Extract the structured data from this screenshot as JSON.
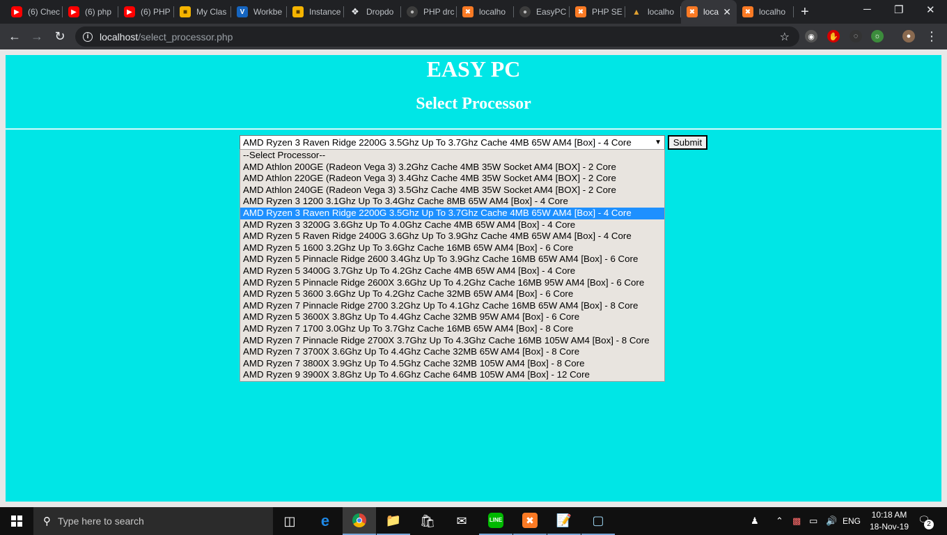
{
  "browser": {
    "tabs": [
      {
        "title": "(6) Chec",
        "icon": "youtube-icon"
      },
      {
        "title": "(6) php",
        "icon": "youtube-icon"
      },
      {
        "title": "(6) PHP",
        "icon": "youtube-icon"
      },
      {
        "title": "My Clas",
        "icon": "box-icon"
      },
      {
        "title": "Workbe",
        "icon": "v-icon"
      },
      {
        "title": "Instance",
        "icon": "box-icon"
      },
      {
        "title": "Dropdo",
        "icon": "dropbox-icon"
      },
      {
        "title": "PHP drc",
        "icon": "github-icon"
      },
      {
        "title": "localho",
        "icon": "xampp-icon"
      },
      {
        "title": "EasyPC",
        "icon": "github-icon"
      },
      {
        "title": "PHP SE",
        "icon": "xampp-icon"
      },
      {
        "title": "localho",
        "icon": "cake-icon"
      },
      {
        "title": "loca",
        "icon": "xampp-icon",
        "active": true
      },
      {
        "title": "localho",
        "icon": "xampp-icon"
      }
    ],
    "new_tab": "+",
    "window_controls": {
      "minimize": "─",
      "restore": "❐",
      "close": "✕"
    },
    "url_host": "localhost",
    "url_path": "/select_processor.php"
  },
  "page": {
    "title": "EASY PC",
    "subtitle": "Select Processor",
    "selected_value": "AMD Ryzen 3 Raven Ridge 2200G 3.5Ghz Up To 3.7Ghz Cache 4MB 65W AM4 [Box] - 4 Core",
    "submit_label": "Submit",
    "options": [
      "--Select Processor--",
      "AMD Athlon 200GE (Radeon Vega 3) 3.2Ghz Cache 4MB 35W Socket AM4 [BOX] - 2 Core",
      "AMD Athlon 220GE (Radeon Vega 3) 3.4Ghz Cache 4MB 35W Socket AM4 [BOX] - 2 Core",
      "AMD Athlon 240GE (Radeon Vega 3) 3.5Ghz Cache 4MB 35W Socket AM4 [BOX] - 2 Core",
      "AMD Ryzen 3 1200 3.1Ghz Up To 3.4Ghz Cache 8MB 65W AM4 [Box] - 4 Core",
      "AMD Ryzen 3 Raven Ridge 2200G 3.5Ghz Up To 3.7Ghz Cache 4MB 65W AM4 [Box] - 4 Core",
      "AMD Ryzen 3 3200G 3.6Ghz Up To 4.0Ghz Cache 4MB 65W AM4 [Box] - 4 Core",
      "AMD Ryzen 5 Raven Ridge 2400G 3.6Ghz Up To 3.9Ghz Cache 4MB 65W AM4 [Box] - 4 Core",
      "AMD Ryzen 5 1600 3.2Ghz Up To 3.6Ghz Cache 16MB 65W AM4 [Box] - 6 Core",
      "AMD Ryzen 5 Pinnacle Ridge 2600 3.4Ghz Up To 3.9Ghz Cache 16MB 65W AM4 [Box] - 6 Core",
      "AMD Ryzen 5 3400G 3.7Ghz Up To 4.2Ghz Cache 4MB 65W AM4 [Box] - 4 Core",
      "AMD Ryzen 5 Pinnacle Ridge 2600X 3.6Ghz Up To 4.2Ghz Cache 16MB 95W AM4 [Box] - 6 Core",
      "AMD Ryzen 5 3600 3.6Ghz Up To 4.2Ghz Cache 32MB 65W AM4 [Box] - 6 Core",
      "AMD Ryzen 7 Pinnacle Ridge 2700 3.2Ghz Up To 4.1Ghz Cache 16MB 65W AM4 [Box] - 8 Core",
      "AMD Ryzen 5 3600X 3.8Ghz Up To 4.4Ghz Cache 32MB 95W AM4 [Box] - 6 Core",
      "AMD Ryzen 7 1700 3.0Ghz Up To 3.7Ghz Cache 16MB 65W AM4 [Box] - 8 Core",
      "AMD Ryzen 7 Pinnacle Ridge 2700X 3.7Ghz Up To 4.3Ghz Cache 16MB 105W AM4 [Box] - 8 Core",
      "AMD Ryzen 7 3700X 3.6Ghz Up To 4.4Ghz Cache 32MB 65W AM4 [Box] - 8 Core",
      "AMD Ryzen 7 3800X 3.9Ghz Up To 4.5Ghz Cache 32MB 105W AM4 [Box] - 8 Core",
      "AMD Ryzen 9 3900X 3.8Ghz Up To 4.6Ghz Cache 64MB 105W AM4 [Box] - 12 Core"
    ],
    "selected_index": 5
  },
  "taskbar": {
    "search_placeholder": "Type here to search",
    "language": "ENG",
    "time": "10:18 AM",
    "date": "18-Nov-19",
    "notification_count": "2"
  }
}
